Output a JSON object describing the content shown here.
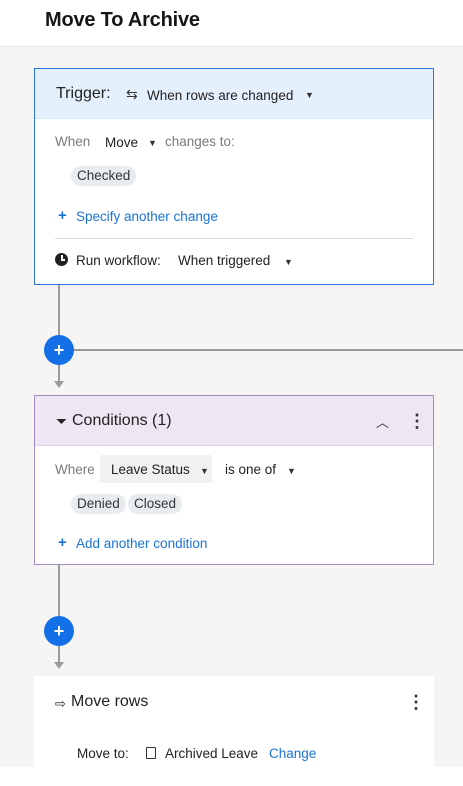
{
  "header": {
    "title": "Move To Archive"
  },
  "trigger": {
    "label": "Trigger:",
    "icon": "cycle-icon",
    "value": "When rows are changed",
    "when_label": "When",
    "field": "Move",
    "changes_to_label": "changes to:",
    "change_values": [
      "Checked"
    ],
    "add_change_link": "Specify another change",
    "run_label": "Run workflow:",
    "run_value": "When triggered",
    "colors": {
      "border": "#2a73d9",
      "header_bg": "#e4f0fb"
    }
  },
  "conditions": {
    "label": "Conditions (1)",
    "icon": "funnel-icon",
    "where_label": "Where",
    "field": "Leave Status",
    "operator": "is one of",
    "values": [
      "Denied",
      "Closed"
    ],
    "add_condition_link": "Add another condition",
    "colors": {
      "border": "#a38bc7",
      "header_bg": "#eee6f3"
    }
  },
  "action": {
    "label": "Move rows",
    "icon": "move-rows-icon",
    "move_to_label": "Move to:",
    "sheet_icon": "sheet-icon",
    "target_sheet": "Archived Leave",
    "change_link": "Change"
  },
  "colors": {
    "accent": "#1370e6",
    "link": "#1a73d9",
    "canvas_bg": "#f6f5f4",
    "connector": "#9a9a9a"
  }
}
